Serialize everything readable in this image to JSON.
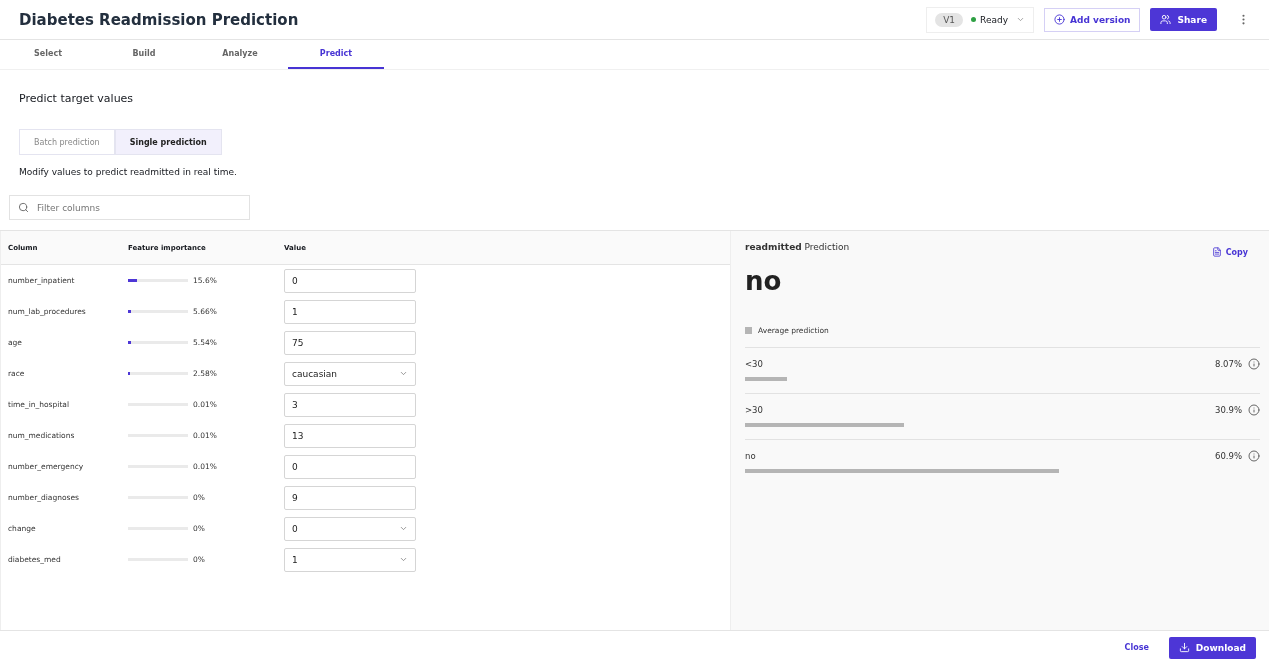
{
  "header": {
    "title": "Diabetes Readmission Prediction",
    "version": "V1",
    "status": "Ready",
    "add_version": "Add version",
    "share": "Share"
  },
  "tabs": [
    {
      "label": "Select",
      "selected": false
    },
    {
      "label": "Build",
      "selected": false
    },
    {
      "label": "Analyze",
      "selected": false
    },
    {
      "label": "Predict",
      "selected": true
    }
  ],
  "section_title": "Predict target values",
  "mode_tabs": [
    {
      "label": "Batch prediction",
      "selected": false
    },
    {
      "label": "Single prediction",
      "selected": true
    }
  ],
  "description": "Modify values to predict readmitted in real time.",
  "filter": {
    "placeholder": "Filter columns"
  },
  "table": {
    "columns": [
      "Column",
      "Feature importance",
      "Value"
    ],
    "rows": [
      {
        "name": "number_inpatient",
        "level": 0.156,
        "importance": "15.6%",
        "kind": "input",
        "value": "0"
      },
      {
        "name": "num_lab_procedures",
        "level": 0.0566,
        "importance": "5.66%",
        "kind": "input",
        "value": "1"
      },
      {
        "name": "age",
        "level": 0.0554,
        "importance": "5.54%",
        "kind": "input",
        "value": "75"
      },
      {
        "name": "race",
        "level": 0.0258,
        "importance": "2.58%",
        "kind": "select",
        "value": "caucasian"
      },
      {
        "name": "time_in_hospital",
        "importance": "0.01%",
        "kind": "input",
        "value": "3"
      },
      {
        "name": "num_medications",
        "importance": "0.01%",
        "kind": "input",
        "value": "13"
      },
      {
        "name": "number_emergency",
        "importance": "0.01%",
        "kind": "input",
        "value": "0"
      },
      {
        "name": "number_diagnoses",
        "importance": "0%",
        "kind": "input",
        "value": "9"
      },
      {
        "name": "change",
        "importance": "0%",
        "kind": "select",
        "value": "0"
      },
      {
        "name": "diabetes_med",
        "importance": "0%",
        "kind": "select",
        "value": "1"
      }
    ]
  },
  "prediction": {
    "heading": "**readmitted** Prediction",
    "copy": "Copy",
    "result": "no",
    "legend": "Average prediction",
    "classes": [
      {
        "label": "<30",
        "percent": "8.07%",
        "level": 0.0807
      },
      {
        "label": ">30",
        "percent": "30.9%",
        "level": 0.309
      },
      {
        "label": "no",
        "percent": "60.9%",
        "level": 0.609
      }
    ]
  },
  "footer": {
    "close": "Close",
    "download": "Download"
  }
}
